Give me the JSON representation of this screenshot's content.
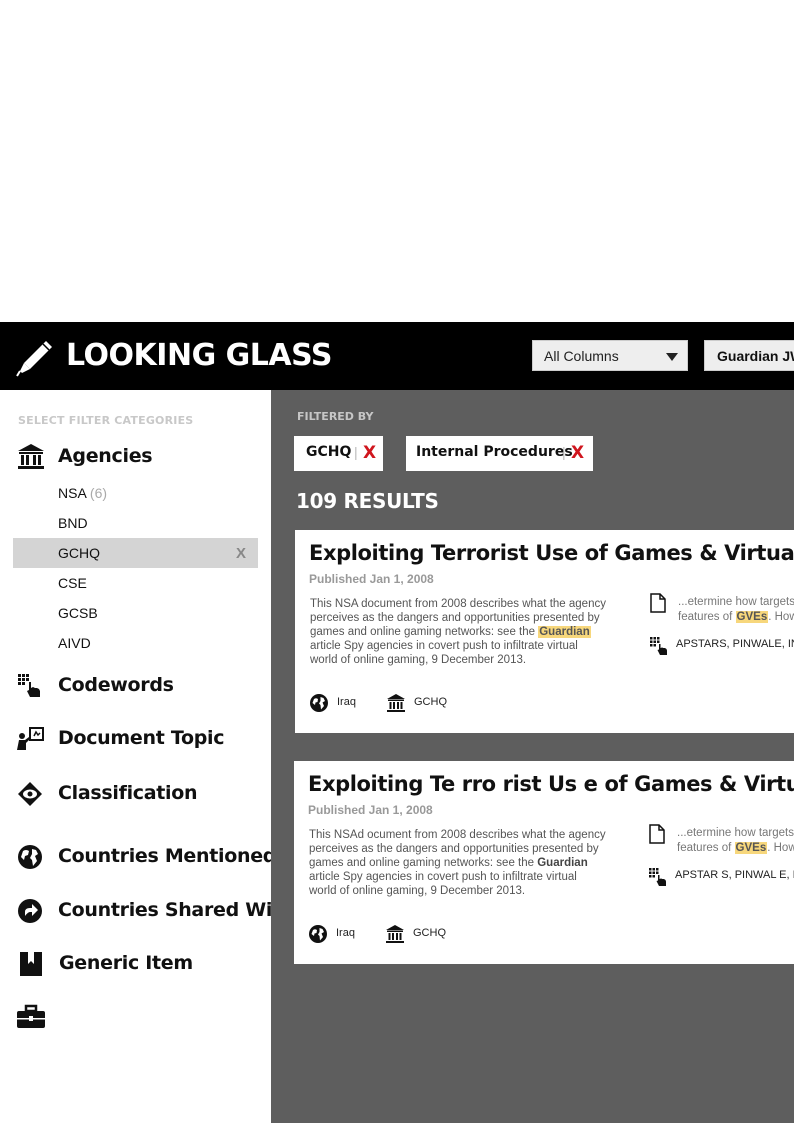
{
  "header": {
    "app_title": "LOOKING GLASS",
    "column_select": "All Columns",
    "search_value": "Guardian JWs"
  },
  "sidebar": {
    "heading": "SELECT FILTER CATEGORIES",
    "categories": [
      {
        "label": "Agencies",
        "icon": "institution-icon"
      },
      {
        "label": "Codewords",
        "icon": "grid-hand-icon"
      },
      {
        "label": "Document Topic",
        "icon": "presenter-icon"
      },
      {
        "label": "Classification",
        "icon": "eye-diamond-icon"
      },
      {
        "label": "Countries Mentioned",
        "icon": "globe-icon"
      },
      {
        "label": "Countries Shared With",
        "icon": "arrow-circle-icon"
      },
      {
        "label": "Generic  Item",
        "icon": "bookmark-icon"
      },
      {
        "label": "",
        "icon": "briefcase-icon"
      }
    ],
    "agencies": [
      {
        "name": "NSA",
        "count": "(6)"
      },
      {
        "name": "BND",
        "count": ""
      },
      {
        "name": "GCHQ",
        "count": "",
        "remove": "X"
      },
      {
        "name": "CSE",
        "count": ""
      },
      {
        "name": "GCSB",
        "count": ""
      },
      {
        "name": "AIVD",
        "count": ""
      }
    ]
  },
  "main": {
    "filtered_by": "FILTERED BY",
    "filters": [
      {
        "label": "GCHQ",
        "sep": "|",
        "remove": "X"
      },
      {
        "label": "Internal Procedures",
        "sep": "|",
        "remove": "X"
      }
    ],
    "results_count": "109 RESULTS",
    "results": [
      {
        "title": "Exploiting Terrorist Use of Games & Virtual Environments",
        "date": "Published Jan 1, 2008",
        "desc_pre": "This NSA document from 2008 describes what the agency perceives as the dangers and opportunities presented by games and online gaming networks: see the ",
        "desc_hl": "Guardian",
        "desc_post": " article Spy agencies in covert push to infiltrate virtual world of online gaming, 9 December 2013.",
        "snippet_pre": "...etermine how targets use",
        "snippet_line2_pre": "features of ",
        "snippet_hl": "GVEs",
        "snippet_post": ". How",
        "codewords": "APSTARS, PINWALE, IN",
        "country": "Iraq",
        "agency": "GCHQ"
      },
      {
        "title": "Exploiting Te rro rist Us e of  Games & Virtual Environments",
        "date": "Published Jan 1, 2008",
        "desc_pre": "This NSAd ocument from 2008 describes what the agency perceives as the dangers and opportunities presented by games and online gaming networks: see the ",
        "desc_hl": "Guardian",
        "desc_post": " article Spy agencies in covert push to infiltrate virtual world of online gaming, 9 December 2013.",
        "snippet_pre": "...etermine how targets use",
        "snippet_line2_pre": "features of ",
        "snippet_hl": "GVEs",
        "snippet_post": ". How",
        "codewords": "APSTAR S, PINWAL E, I",
        "country": "Iraq",
        "agency": "GCHQ"
      }
    ]
  },
  "colors": {
    "header_bg": "#000000",
    "main_bg": "#5e5e5e",
    "highlight": "#f7d77c",
    "remove_x": "#d0161e",
    "active_row": "#d4d4d4"
  }
}
